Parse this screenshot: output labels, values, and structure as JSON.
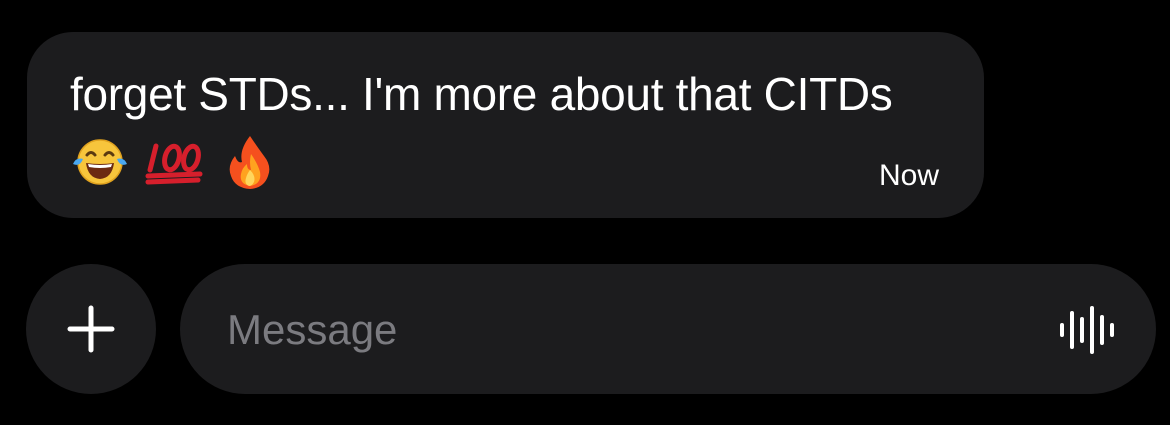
{
  "message": {
    "text": "forget STDs... I'm more about that CITDs",
    "emojis": [
      "face-with-tears-of-joy",
      "hundred-points",
      "fire"
    ],
    "timestamp": "Now"
  },
  "composer": {
    "placeholder": "Message",
    "value": "",
    "add_icon": "plus-icon",
    "voice_icon": "waveform-icon"
  },
  "colors": {
    "background": "#000000",
    "bubble": "#1c1c1e",
    "text": "#ffffff",
    "placeholder": "#7b7b80"
  }
}
